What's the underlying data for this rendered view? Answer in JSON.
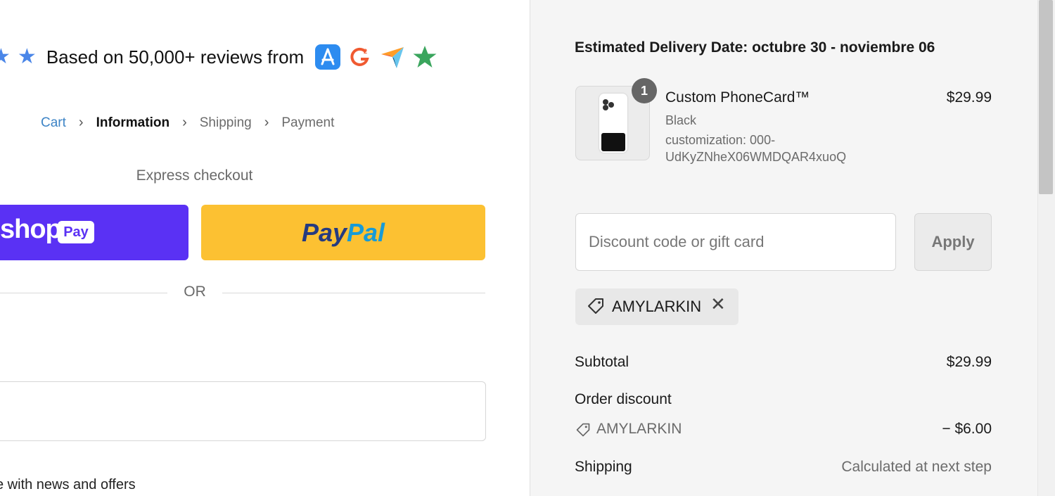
{
  "reviews": {
    "text": "Based on 50,000+ reviews from",
    "star_color": "#4a86e8",
    "logos": [
      "app-store-icon",
      "g2-icon",
      "capterra-icon",
      "trustpilot-icon"
    ]
  },
  "breadcrumb": {
    "cart": "Cart",
    "information": "Information",
    "shipping": "Shipping",
    "payment": "Payment",
    "separator": "›"
  },
  "express": {
    "label": "Express checkout",
    "shop_word": "shop",
    "shop_pay_badge": "Pay",
    "paypal_part1": "Pay",
    "paypal_part2": "Pal",
    "shop_color": "#5a31f4",
    "paypal_color": "#fcc132"
  },
  "divider": {
    "or": "OR"
  },
  "newsletter": {
    "text": "e with news and offers"
  },
  "summary": {
    "estimated_delivery": "Estimated Delivery Date: octubre 30 - noviembre 06",
    "product": {
      "quantity": "1",
      "title": "Custom PhoneCard™",
      "variant": "Black",
      "customization": "customization: 000-UdKyZNheX06WMDQAR4xuoQ",
      "price": "$29.99"
    },
    "discount": {
      "placeholder": "Discount code or gift card",
      "apply_label": "Apply",
      "applied_code": "AMYLARKIN"
    },
    "subtotal_label": "Subtotal",
    "subtotal_value": "$29.99",
    "order_discount_label": "Order discount",
    "order_discount_code": "AMYLARKIN",
    "order_discount_value": "− $6.00",
    "shipping_label": "Shipping",
    "shipping_value": "Calculated at next step"
  }
}
